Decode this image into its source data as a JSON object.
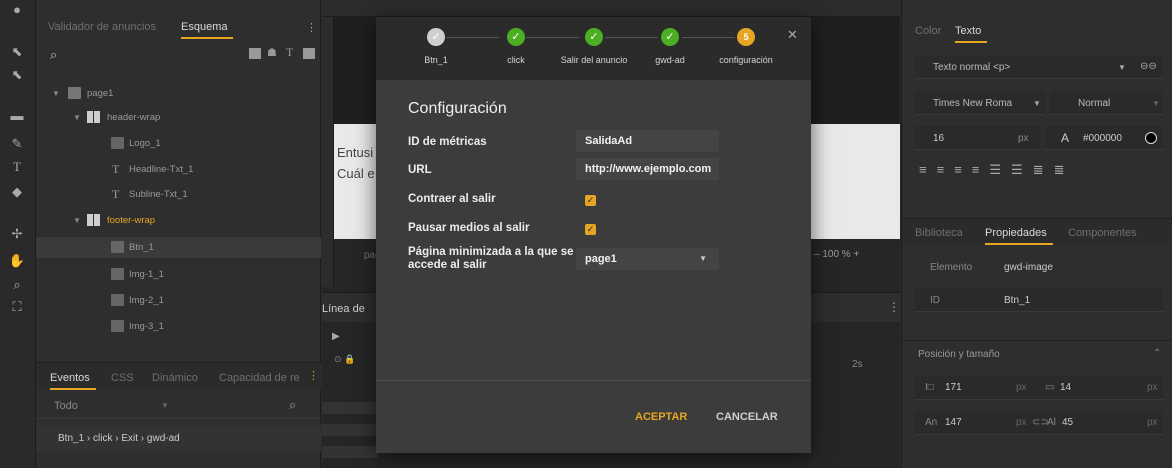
{
  "left_panel": {
    "tabs": [
      "Validador de anuncios",
      "Esquema"
    ],
    "tree": [
      {
        "label": "page1",
        "level": 0,
        "type": "page"
      },
      {
        "label": "header-wrap",
        "level": 1,
        "type": "group"
      },
      {
        "label": "Logo_1",
        "level": 2,
        "type": "image"
      },
      {
        "label": "Headline-Txt_1",
        "level": 2,
        "type": "text"
      },
      {
        "label": "Subline-Txt_1",
        "level": 2,
        "type": "text"
      },
      {
        "label": "footer-wrap",
        "level": 1,
        "type": "group"
      },
      {
        "label": "Btn_1",
        "level": 2,
        "type": "image"
      },
      {
        "label": "Img-1_1",
        "level": 2,
        "type": "image"
      },
      {
        "label": "Img-2_1",
        "level": 2,
        "type": "image"
      },
      {
        "label": "Img-3_1",
        "level": 2,
        "type": "image"
      }
    ],
    "bottom_tabs": [
      "Eventos",
      "CSS",
      "Dinámico",
      "Capacidad de re"
    ],
    "filter_value": "Todo",
    "event_item": "Btn_1 › click › Exit › gwd-ad"
  },
  "canvas": {
    "text_line1": "Entusi",
    "text_line2": "Cuál e",
    "page_label": "pag",
    "zoom": "100 %",
    "timeline_title": "Línea de",
    "timeline_time": "2s"
  },
  "right_panel": {
    "tabs": [
      "Color",
      "Texto"
    ],
    "text_style": "Texto normal <p>",
    "font_family": "Times New Roma",
    "font_weight": "Normal",
    "font_size": "16",
    "font_unit": "px",
    "font_color": "#000000",
    "tabs2": [
      "Biblioteca",
      "Propiedades",
      "Componentes"
    ],
    "element_label": "Elemento",
    "element_value": "gwd-image",
    "id_label": "ID",
    "id_value": "Btn_1",
    "section_title": "Posición y tamaño",
    "x": "171",
    "y": "14",
    "unit": "px",
    "width_label": "An",
    "width": "147",
    "height_label": "Al",
    "height": "45"
  },
  "dialog": {
    "steps": [
      {
        "label": "Btn_1",
        "state": "done"
      },
      {
        "label": "click",
        "state": "done"
      },
      {
        "label": "Salir del anuncio",
        "state": "done"
      },
      {
        "label": "gwd-ad",
        "state": "done"
      },
      {
        "label": "configuración",
        "state": "current",
        "number": "5"
      }
    ],
    "title": "Configuración",
    "fields": {
      "metrics_id_label": "ID de métricas",
      "metrics_id_value": "SalidaAd",
      "url_label": "URL",
      "url_value": "http://www.ejemplo.com",
      "collapse_label": "Contraer al salir",
      "pause_label": "Pausar medios al salir",
      "minimized_page_label": "Página minimizada a la que se accede al salir",
      "minimized_page_value": "page1"
    },
    "accept": "ACEPTAR",
    "cancel": "CANCELAR"
  },
  "colors": {
    "accent": "#e6a623",
    "done": "#4caf23",
    "pending": "#cfcfcf"
  }
}
